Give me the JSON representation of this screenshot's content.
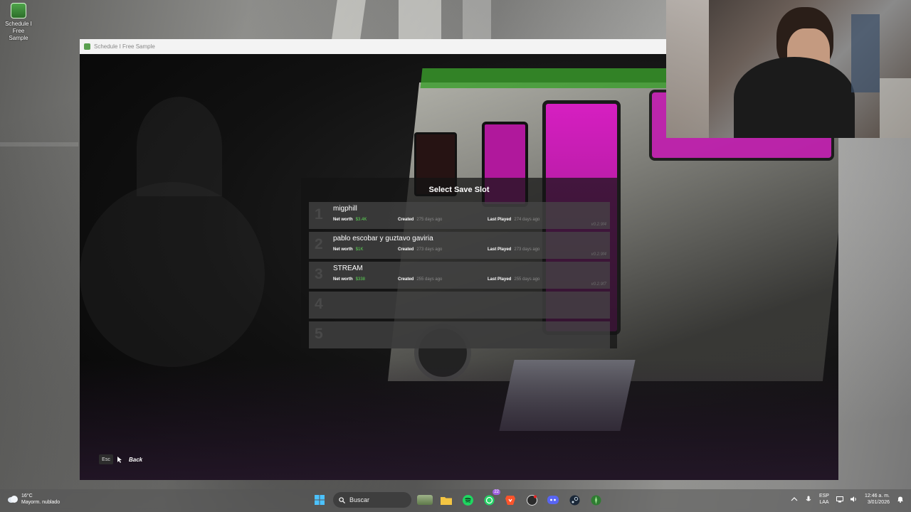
{
  "desktop": {
    "shortcut_label": "Schedule I Free Sample"
  },
  "window": {
    "title": "Schedule I Free Sample"
  },
  "save_menu": {
    "title": "Select Save Slot",
    "labels": {
      "net_worth": "Net worth",
      "created": "Created",
      "last_played": "Last Played"
    },
    "slots": [
      {
        "number": "1",
        "name": "migphill",
        "net_worth": "$3.4K",
        "created": "275 days ago",
        "last_played": "274 days ago",
        "version": "v0.2.9f4"
      },
      {
        "number": "2",
        "name": "pablo escobar y guztavo gaviria",
        "net_worth": "$1K",
        "created": "273 days ago",
        "last_played": "273 days ago",
        "version": "v0.2.9f4"
      },
      {
        "number": "3",
        "name": "STREAM",
        "net_worth": "$338",
        "created": "255 days ago",
        "last_played": "255 days ago",
        "version": "v0.2.9f7"
      },
      {
        "number": "4"
      },
      {
        "number": "5"
      }
    ],
    "back_hint": {
      "key": "Esc",
      "label": "Back"
    }
  },
  "taskbar": {
    "weather_temp": "16°C",
    "weather_desc": "Mayorm. nublado",
    "search_placeholder": "Buscar",
    "whatsapp_badge": "22",
    "lang_line1": "ESP",
    "lang_line2": "LAA",
    "time": "12:46 a. m.",
    "date": "3/01/2026"
  },
  "colors": {
    "money": "#5cd655",
    "rv_magenta": "#d61fc1",
    "rv_green": "#3a9e2a"
  }
}
